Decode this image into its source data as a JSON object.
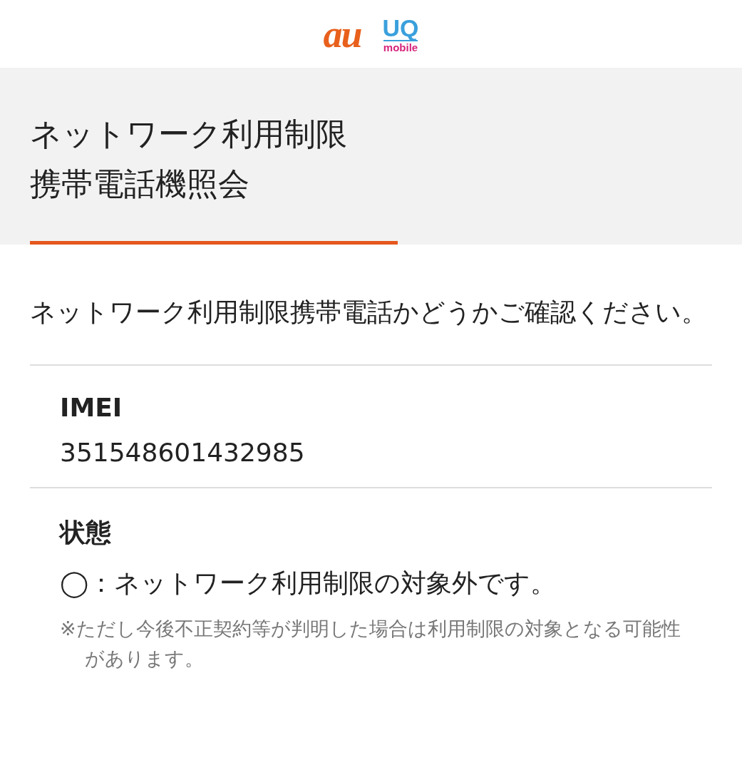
{
  "header": {
    "logos": [
      {
        "kind": "au",
        "text": "au"
      },
      {
        "kind": "uq",
        "text": "UQ",
        "sub": "mobile"
      }
    ]
  },
  "title": {
    "lines": [
      "ネットワーク利用制限",
      "携帯電話機照会"
    ]
  },
  "intro": "ネットワーク利用制限携帯電話かどうかご確認ください。",
  "fields": [
    {
      "label": "IMEI",
      "value": "351548601432985"
    },
    {
      "label": "状態",
      "value": "◯：ネットワーク利用制限の対象外です。",
      "note": "※ただし今後不正契約等が判明した場合は利用制限の対象となる可能性があります。"
    }
  ]
}
